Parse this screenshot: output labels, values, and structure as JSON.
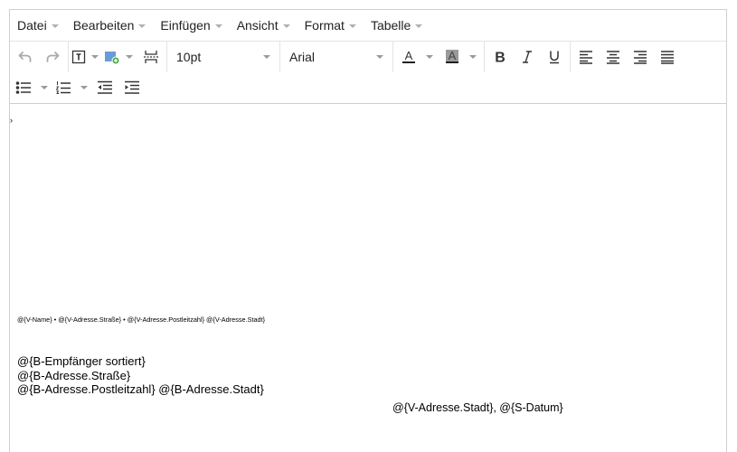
{
  "menubar": {
    "items": [
      "Datei",
      "Bearbeiten",
      "Einfügen",
      "Ansicht",
      "Format",
      "Tabelle"
    ]
  },
  "toolbar": {
    "font_size": "10pt",
    "font_family": "Arial",
    "icons": [
      "undo-icon",
      "redo-icon",
      "insert-field-icon",
      "insert-image-icon",
      "page-break-icon",
      "text-color-icon",
      "background-color-icon",
      "bold-icon",
      "italic-icon",
      "underline-icon",
      "align-left-icon",
      "align-center-icon",
      "align-right-icon",
      "justify-icon",
      "bullet-list-icon",
      "numbered-list-icon",
      "outdent-icon",
      "indent-icon"
    ],
    "colors": {
      "text_color": "#222222",
      "background_color": "#9a9a9a",
      "disabled": "#aaaaaa"
    }
  },
  "document": {
    "sender_line": "@{V-Name} • @{V-Adresse.Straße} • @{V-Adresse.Postleitzahl} @{V-Adresse.Stadt}",
    "recipient": {
      "line1": "@{B-Empfänger sortiert}",
      "line2": "@{B-Adresse.Straße}",
      "line3": "@{B-Adresse.Postleitzahl} @{B-Adresse.Stadt}"
    },
    "place_date": "@{V-Adresse.Stadt}, @{S-Datum}"
  }
}
